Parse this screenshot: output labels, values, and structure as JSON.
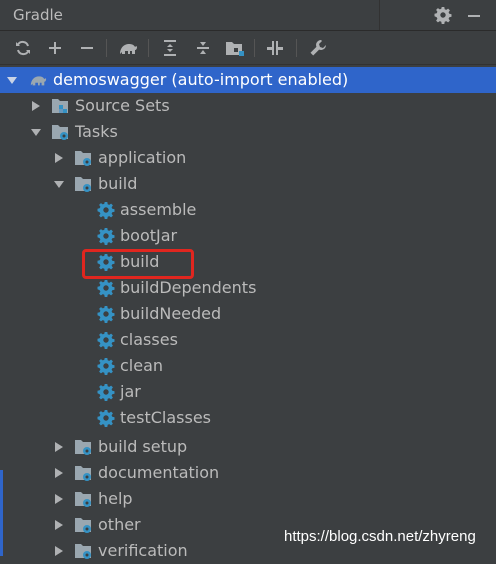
{
  "panel": {
    "title": "Gradle",
    "settings_icon": "gear-icon",
    "minimize_icon": "minimize-icon"
  },
  "toolbar": {
    "buttons": [
      {
        "name": "refresh",
        "icon": "refresh-icon"
      },
      {
        "name": "add",
        "icon": "plus-icon"
      },
      {
        "name": "remove",
        "icon": "minus-icon"
      },
      {
        "name": "execute-task",
        "icon": "gradle-elephant-icon"
      },
      {
        "name": "expand-all",
        "icon": "expand-all-icon"
      },
      {
        "name": "collapse-all",
        "icon": "collapse-all-icon"
      },
      {
        "name": "show-dependencies",
        "icon": "dependencies-icon"
      },
      {
        "name": "toggle-offline",
        "icon": "offline-icon"
      },
      {
        "name": "build-tool-settings",
        "icon": "wrench-icon"
      }
    ]
  },
  "tree": {
    "root": {
      "label": "demoswagger (auto-import enabled)",
      "icon": "gradle-elephant-icon",
      "selected": true
    },
    "source_sets": {
      "label": "Source Sets"
    },
    "tasks": {
      "label": "Tasks"
    },
    "groups": {
      "application": "application",
      "build": "build",
      "build_setup": "build setup",
      "documentation": "documentation",
      "help": "help",
      "other": "other",
      "verification": "verification"
    },
    "build_tasks": [
      "assemble",
      "bootJar",
      "build",
      "buildDependents",
      "buildNeeded",
      "classes",
      "clean",
      "jar",
      "testClasses"
    ]
  },
  "highlighted_task": "build",
  "watermark": "https://blog.csdn.net/zhyreng",
  "colors": {
    "background": "#3c3f41",
    "selection": "#2f65ca",
    "text": "#bbbbbb",
    "gear": "#3592c4",
    "highlight_box": "#e0261f"
  }
}
